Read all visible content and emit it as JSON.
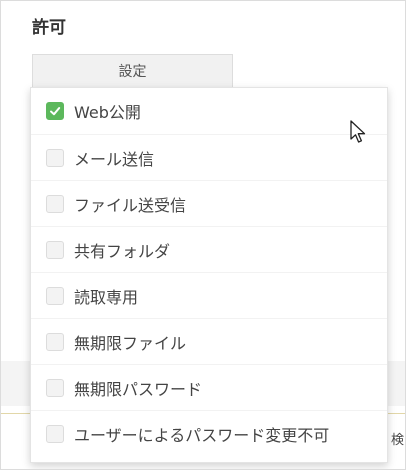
{
  "section": {
    "label": "許可"
  },
  "settings_button": {
    "label": "設定"
  },
  "background": {
    "right_text": "検"
  },
  "dropdown": {
    "options": [
      {
        "label": "Web公開",
        "checked": true
      },
      {
        "label": "メール送信",
        "checked": false
      },
      {
        "label": "ファイル送受信",
        "checked": false
      },
      {
        "label": "共有フォルダ",
        "checked": false
      },
      {
        "label": "読取専用",
        "checked": false
      },
      {
        "label": "無期限ファイル",
        "checked": false
      },
      {
        "label": "無期限パスワード",
        "checked": false
      },
      {
        "label": "ユーザーによるパスワード変更不可",
        "checked": false
      }
    ]
  },
  "colors": {
    "checked": "#5cb85c",
    "button_bg": "#f1f1f1",
    "text": "#444444"
  },
  "icons": {
    "checkmark": "checkmark-icon",
    "cursor": "mouse-pointer-icon"
  }
}
